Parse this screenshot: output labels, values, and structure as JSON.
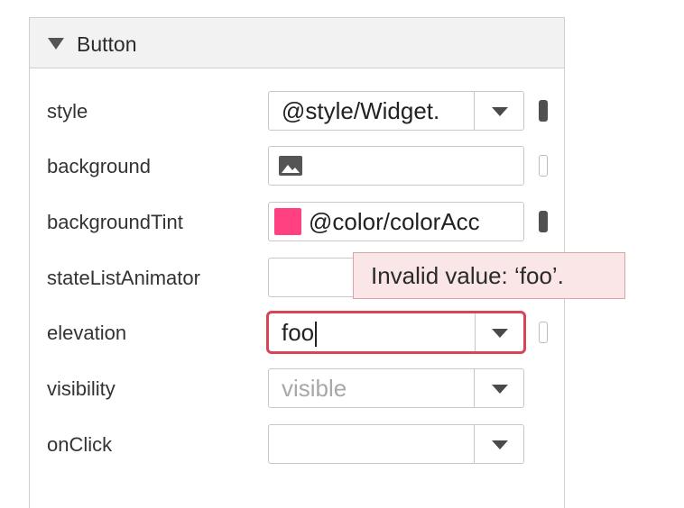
{
  "section": {
    "title": "Button",
    "collapse_icon": "triangle-down-icon"
  },
  "rows": [
    {
      "label": "style",
      "value": "@style/Widget.",
      "kind": "dropdown"
    },
    {
      "label": "background",
      "value": "",
      "icon": "image-icon",
      "kind": "text"
    },
    {
      "label": "backgroundTint",
      "value": "@color/colorAcc",
      "swatch_color": "#ff4081",
      "kind": "text"
    },
    {
      "label": "stateListAnimator",
      "value": "",
      "kind": "text"
    },
    {
      "label": "elevation",
      "value": "foo",
      "kind": "dropdown",
      "state": "error"
    },
    {
      "label": "visibility",
      "value": "",
      "placeholder": "visible",
      "kind": "dropdown"
    },
    {
      "label": "onClick",
      "value": "",
      "kind": "dropdown"
    }
  ],
  "tooltip": {
    "text": "Invalid value: ‘foo’."
  },
  "colors": {
    "error_border": "#d94457",
    "tooltip_bg": "#fae6e7",
    "accent_swatch": "#ff4081"
  }
}
